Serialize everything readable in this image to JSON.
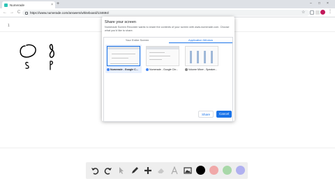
{
  "browser": {
    "tab_title": "Numerade",
    "tab_close": "×",
    "new_tab": "+",
    "window_controls": {
      "minimize": "–",
      "maximize": "□",
      "close": "×"
    },
    "nav": {
      "back": "←",
      "forward": "→",
      "reload": "C"
    },
    "url": "https://www.numerade.com/answers/whiteboard/134694/",
    "star": "☆",
    "menu": "⋮"
  },
  "page": {
    "page_number": "1"
  },
  "dialog": {
    "title": "Share your screen",
    "description": "Numerade Screen Recorder wants to share the contents of your screen with www.numerade.com. Choose what you'd like to share.",
    "tabs": [
      {
        "label": "Your Entire Screen",
        "active": false
      },
      {
        "label": "Application Window",
        "active": true
      }
    ],
    "windows": [
      {
        "label": "Numerade - Google C...",
        "selected": true,
        "icon_color": "#4285f4"
      },
      {
        "label": "Numerade - Google Chr...",
        "selected": false,
        "icon_color": "#4285f4"
      },
      {
        "label": "Volume Mixer - Speaker...",
        "selected": false,
        "icon_color": "#888888"
      }
    ],
    "share_label": "Share",
    "cancel_label": "Cancel"
  },
  "drawing_toolbar": {
    "tools": [
      "undo-icon",
      "redo-icon",
      "pointer-icon",
      "pen-icon",
      "add-icon",
      "eraser-icon",
      "text-icon",
      "image-icon"
    ],
    "colors": [
      "#000000",
      "#f0a8a8",
      "#a8d8a8",
      "#b0b0f0"
    ]
  }
}
